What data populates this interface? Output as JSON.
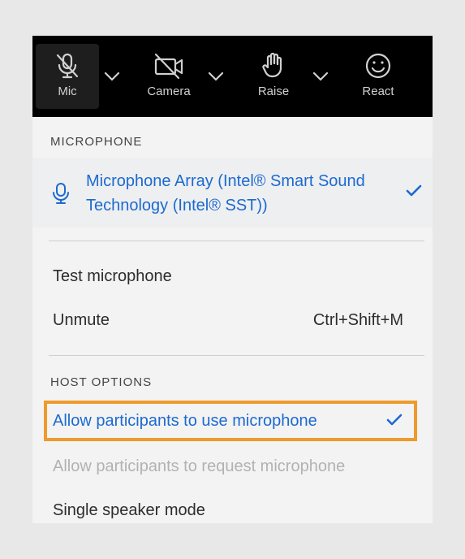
{
  "toolbar": {
    "mic_label": "Mic",
    "camera_label": "Camera",
    "raise_label": "Raise",
    "react_label": "React"
  },
  "menu": {
    "microphone_section": "MICROPHONE",
    "selected_device": "Microphone Array (Intel® Smart Sound Technology (Intel® SST))",
    "test_microphone": "Test microphone",
    "unmute": "Unmute",
    "unmute_shortcut": "Ctrl+Shift+M",
    "host_options_section": "HOST OPTIONS",
    "allow_use": "Allow participants to use microphone",
    "allow_request": "Allow participants to request microphone",
    "single_speaker": "Single speaker mode"
  },
  "colors": {
    "accent_blue": "#1c6ad1",
    "highlight_orange": "#ee9a2c",
    "toolbar_bg": "#000000"
  },
  "icons": [
    "mic-muted-icon",
    "camera-off-icon",
    "raise-hand-icon",
    "smiley-icon",
    "chevron-down-icon",
    "microphone-icon",
    "checkmark-icon"
  ]
}
